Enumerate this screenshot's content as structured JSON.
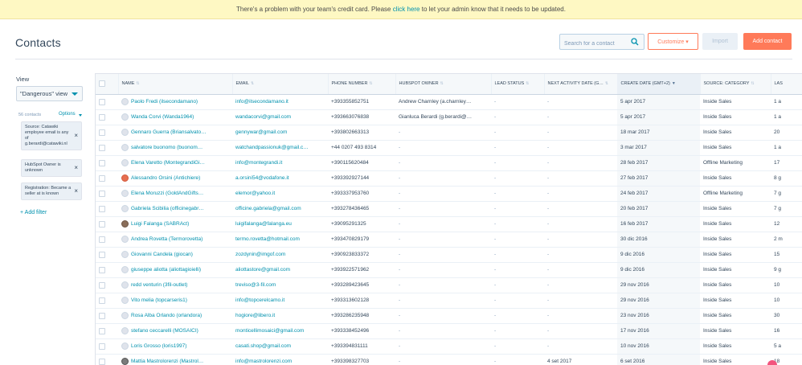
{
  "banner": {
    "text_before": "There's a problem with your team's credit card. Please ",
    "link": "click here",
    "text_after": " to let your admin know that it needs to be updated."
  },
  "header": {
    "title": "Contacts",
    "search_placeholder": "Search for a contact",
    "customize_label": "Customize ▾",
    "import_label": "Import",
    "add_label": "Add contact"
  },
  "sidebar": {
    "view_label": "View",
    "view_value": "\"Dangerous\" view",
    "contact_count": "56 contacts",
    "options_label": "Options",
    "filters": [
      "Source: Catawiki employee email is any of g.berardi@catawiki.nl",
      "HubSpot Owner is unknown",
      "Registration: Became a seller at is known"
    ],
    "add_filter": "+ Add filter"
  },
  "table": {
    "columns": [
      "NAME",
      "EMAIL",
      "PHONE NUMBER",
      "HUBSPOT OWNER",
      "LEAD STATUS",
      "NEXT ACTIVITY DATE (G…",
      "CREATE DATE (GMT+2)",
      "SOURCE: CATEGORY",
      "LAS"
    ],
    "rows": [
      {
        "name": "Paolo Fredi (ilsecondamano)",
        "email": "info@ilsecondamano.it",
        "phone": "+393355852751",
        "owner": "Andrew Charnley (a.charnley…",
        "lead": "-",
        "next": "-",
        "created": "5 apr 2017",
        "source": "Inside Sales",
        "last": "1 a",
        "avatar": "default"
      },
      {
        "name": "Wanda Corvi (Wanda1964)",
        "email": "wandacorvi@gmail.com",
        "phone": "+393663076838",
        "owner": "Gianluca Berardi (g.berardi@…",
        "lead": "-",
        "next": "-",
        "created": "5 apr 2017",
        "source": "Inside Sales",
        "last": "1 a",
        "avatar": "default"
      },
      {
        "name": "Gennaro Guerra (Briansalvato…",
        "email": "gennywar@gmail.com",
        "phone": "+393802663313",
        "owner": "-",
        "lead": "-",
        "next": "-",
        "created": "18 mar 2017",
        "source": "Inside Sales",
        "last": "20",
        "avatar": "default"
      },
      {
        "name": "salvatore buonomo (buonom…",
        "email": "watchandpassionuk@gmail.c…",
        "phone": "+44 0207 493 8314",
        "owner": "-",
        "lead": "-",
        "next": "-",
        "created": "3 mar 2017",
        "source": "Inside Sales",
        "last": "1 a",
        "avatar": "default"
      },
      {
        "name": "Elena Varetto (MontegrandiGi…",
        "email": "info@montegrandi.it",
        "phone": "+390115620484",
        "owner": "-",
        "lead": "-",
        "next": "-",
        "created": "28 feb 2017",
        "source": "Offline Marketing",
        "last": "17",
        "avatar": "default"
      },
      {
        "name": "Alessandro Orsini (Antichiere)",
        "email": "a.orsini54@vodafone.it",
        "phone": "+393392927144",
        "owner": "-",
        "lead": "-",
        "next": "-",
        "created": "27 feb 2017",
        "source": "Inside Sales",
        "last": "8 g",
        "avatar": "red"
      },
      {
        "name": "Elena Moruzzi (GoldAndGifts…",
        "email": "elemor@yahoo.it",
        "phone": "+393337953760",
        "owner": "-",
        "lead": "-",
        "next": "-",
        "created": "24 feb 2017",
        "source": "Offline Marketing",
        "last": "7 g",
        "avatar": "default"
      },
      {
        "name": "Gabriela Scibilia (officinegabr…",
        "email": "officine.gabriela@gmail.com",
        "phone": "+393278436465",
        "owner": "-",
        "lead": "-",
        "next": "-",
        "created": "20 feb 2017",
        "source": "Inside Sales",
        "last": "7 g",
        "avatar": "default"
      },
      {
        "name": "Luigi Falanga (SABRAct)",
        "email": "luigifalanga@falanga.eu",
        "phone": "+39095291325",
        "owner": "-",
        "lead": "-",
        "next": "-",
        "created": "16 feb 2017",
        "source": "Inside Sales",
        "last": "12",
        "avatar": "img"
      },
      {
        "name": "Andrea Rovetta (Termorovetta)",
        "email": "termo.rovetta@hotmail.com",
        "phone": "+393470829179",
        "owner": "-",
        "lead": "-",
        "next": "-",
        "created": "30 dic 2016",
        "source": "Inside Sales",
        "last": "2 m",
        "avatar": "default"
      },
      {
        "name": "Giovanni Candela (giocan)",
        "email": "zozdynin@imgof.com",
        "phone": "+390923833372",
        "owner": "-",
        "lead": "-",
        "next": "-",
        "created": "9 dic 2016",
        "source": "Inside Sales",
        "last": "15",
        "avatar": "default"
      },
      {
        "name": "giuseppe aliotta (aliottagioielli)",
        "email": "aliottastore@gmail.com",
        "phone": "+393922571962",
        "owner": "-",
        "lead": "-",
        "next": "-",
        "created": "9 dic 2016",
        "source": "Inside Sales",
        "last": "9 g",
        "avatar": "default"
      },
      {
        "name": "redd venturin (3fil-outlet)",
        "email": "treviso@3-fil.com",
        "phone": "+393289423645",
        "owner": "-",
        "lead": "-",
        "next": "-",
        "created": "29 nov 2016",
        "source": "Inside Sales",
        "last": "10",
        "avatar": "default"
      },
      {
        "name": "Vito melia (topcarseris1)",
        "email": "info@topcerelcamo.it",
        "phone": "+393313602128",
        "owner": "-",
        "lead": "-",
        "next": "-",
        "created": "29 nov 2016",
        "source": "Inside Sales",
        "last": "10",
        "avatar": "default"
      },
      {
        "name": "Rosa Alba Orlando (orlandora)",
        "email": "hogiore@libero.it",
        "phone": "+393286235948",
        "owner": "-",
        "lead": "-",
        "next": "-",
        "created": "23 nov 2016",
        "source": "Inside Sales",
        "last": "30",
        "avatar": "default"
      },
      {
        "name": "stefano ceccarelli (MOSAICI)",
        "email": "monticellimosaici@gmail.com",
        "phone": "+393338452496",
        "owner": "-",
        "lead": "-",
        "next": "-",
        "created": "17 nov 2016",
        "source": "Inside Sales",
        "last": "16",
        "avatar": "default"
      },
      {
        "name": "Loris Grosso (loris1997)",
        "email": "casati.shop@gmail.com",
        "phone": "+393394831111",
        "owner": "-",
        "lead": "-",
        "next": "-",
        "created": "10 nov 2016",
        "source": "Inside Sales",
        "last": "5 a",
        "avatar": "default"
      },
      {
        "name": "Mattia Mastrolorenzi (Mastrol…",
        "email": "info@mastrolorenzi.com",
        "phone": "+393398327703",
        "owner": "-",
        "lead": "-",
        "next": "4 set 2017",
        "created": "6 set 2016",
        "source": "Inside Sales",
        "last": "18",
        "avatar": "img2"
      }
    ]
  }
}
